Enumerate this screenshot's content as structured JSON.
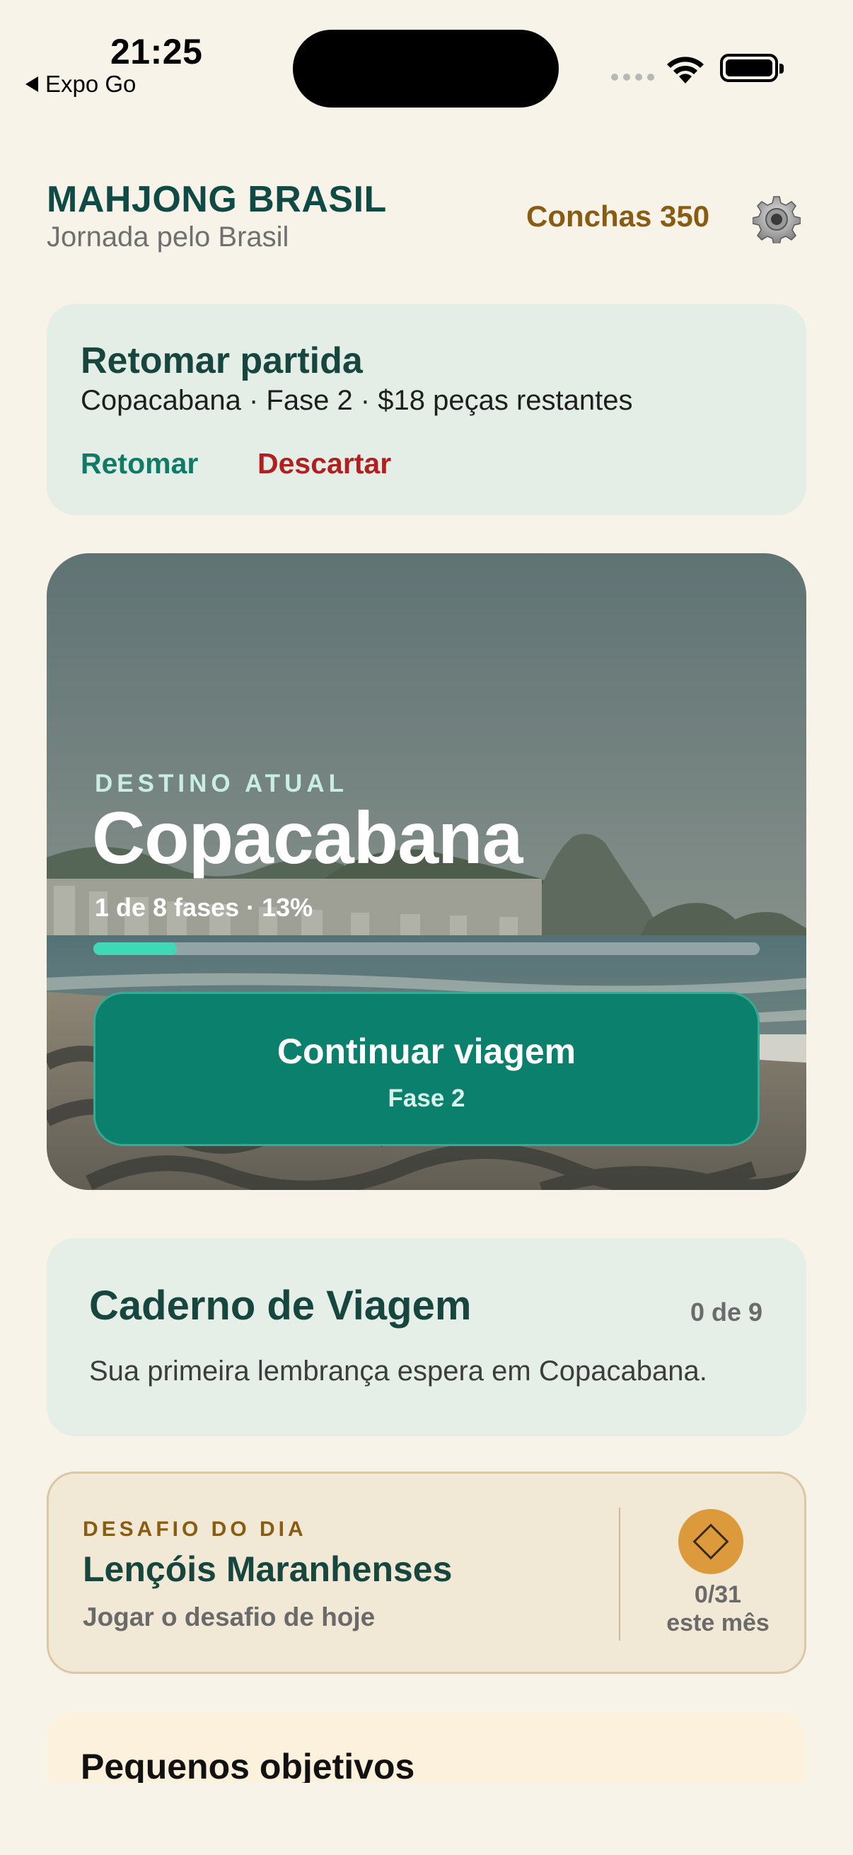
{
  "status": {
    "time": "21:25",
    "back_label": "Expo Go"
  },
  "header": {
    "title": "MAHJONG BRASIL",
    "subtitle": "Jornada pelo Brasil",
    "shells_label": "Conchas 350"
  },
  "resume": {
    "title": "Retomar partida",
    "description": "Copacabana · Fase 2 · $18 peças restantes",
    "resume_label": "Retomar",
    "discard_label": "Descartar"
  },
  "destination": {
    "eyebrow": "DESTINO ATUAL",
    "name": "Copacabana",
    "progress_text": "1 de 8 fases · 13%",
    "progress_fraction": 0.125,
    "continue_label": "Continuar viagem",
    "continue_sub": "Fase 2"
  },
  "notebook": {
    "title": "Caderno de Viagem",
    "count": "0 de 9",
    "description": "Sua primeira lembrança espera em Copacabana."
  },
  "daily": {
    "eyebrow": "DESAFIO DO DIA",
    "title": "Lençóis Maranhenses",
    "subtitle": "Jogar o desafio de hoje",
    "count": "0/31",
    "period": "este mês"
  },
  "objectives": {
    "title": "Pequenos objetivos"
  },
  "colors": {
    "background": "#f7f3e9",
    "brand_green": "#0f4a44",
    "accent_teal": "#0a806d",
    "danger": "#b02020",
    "gold": "#8a5c12"
  },
  "icons": {
    "settings": "gear-icon",
    "challenge": "diamond-icon"
  }
}
